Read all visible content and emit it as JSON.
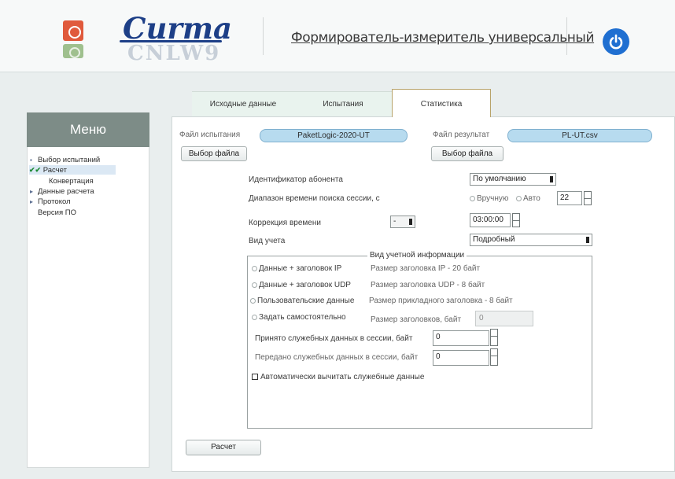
{
  "header": {
    "brand": "Curma",
    "brand_mirror": "CNLW9",
    "title": "Формирователь-измеритель универсальный"
  },
  "tabs": [
    {
      "label": "Исходные данные",
      "active": false
    },
    {
      "label": "Испытания",
      "active": false
    },
    {
      "label": "Статистика",
      "active": true
    }
  ],
  "sidebar": {
    "title": "Меню",
    "items": [
      {
        "label": "Выбор испытаний",
        "bullet": "▪"
      },
      {
        "label": "Расчет",
        "bullet": "▪",
        "checked": true,
        "active": true
      },
      {
        "label": "Конвертация",
        "bullet": ""
      },
      {
        "label": "Данные расчета",
        "bullet": "▸"
      },
      {
        "label": "Протокол",
        "bullet": "▸"
      },
      {
        "label": "Версия ПО",
        "bullet": ""
      }
    ]
  },
  "files": {
    "test_label": "Файл испытания",
    "test_value": "PaketLogic-2020-UT",
    "test_button": "Выбор файла",
    "result_label": "Файл результат",
    "result_value": "PL-UT.csv",
    "result_button": "Выбор файла"
  },
  "form": {
    "subscriber_label": "Идентификатор абонента",
    "subscriber_value": "По умолчанию",
    "range_label": "Диапазон времени поиска сессии, с",
    "range_manual": "Вручную",
    "range_auto": "Авто",
    "range_value": "22",
    "correction_label": "Коррекция времени",
    "correction_sign": "-",
    "correction_value": "03:00:00",
    "account_label": "Вид учета",
    "account_value": "Подробный"
  },
  "group": {
    "legend": "Вид учетной информации",
    "options": [
      {
        "label": "Данные + заголовок IP",
        "desc": "Размер заголовка IP - 20 байт"
      },
      {
        "label": "Данные + заголовок UDP",
        "desc": "Размер заголовка UDP - 8 байт"
      },
      {
        "label": "Пользовательские данные",
        "desc": "Размер прикладного заголовка - 8 байт"
      },
      {
        "label": "Задать самостоятельно",
        "desc": "Размер заголовков, байт"
      }
    ],
    "custom_value": "0",
    "received_label": "Принято служебных данных в сессии, байт",
    "received_value": "0",
    "sent_label": "Передано служебных данных в сессии, байт",
    "sent_value": "0",
    "auto_subtract_label": "Автоматически вычитать служебные данные"
  },
  "actions": {
    "calc_button": "Расчет"
  },
  "colors": {
    "brand": "#1d3f87",
    "power": "#1f6fd1",
    "menu_header": "#7d8c87",
    "file_field": "#b7dbef"
  }
}
